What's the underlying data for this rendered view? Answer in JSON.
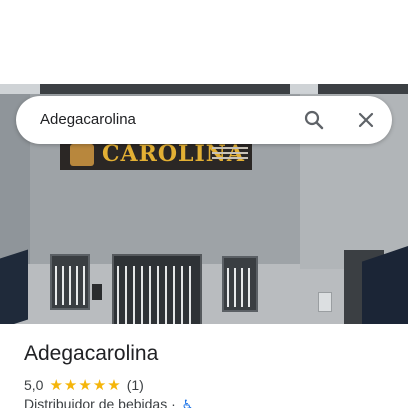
{
  "search": {
    "query": "Adegacarolina",
    "search_icon": "search-icon",
    "close_icon": "close-icon"
  },
  "photo": {
    "sign_text": "CAROLINA"
  },
  "place": {
    "name": "Adegacarolina",
    "rating": "5,0",
    "stars": 5,
    "review_count": "(1)",
    "category": "Distribuidor de bebidas",
    "separator": "·",
    "accessibility_icon": "wheelchair-icon"
  },
  "colors": {
    "star": "#f5b50a",
    "accessibility": "#1a73e8",
    "text_primary": "#202124",
    "text_secondary": "#3c4043"
  }
}
